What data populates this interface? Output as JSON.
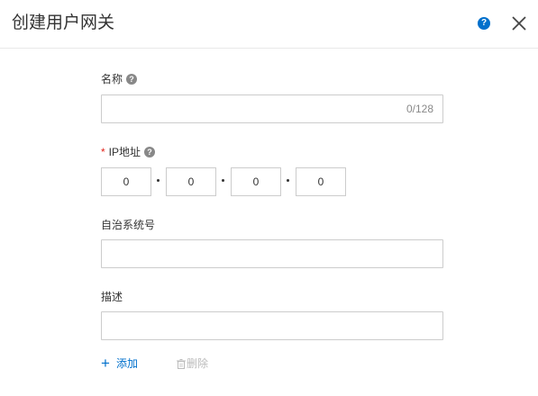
{
  "dialog": {
    "title": "创建用户网关"
  },
  "form": {
    "name": {
      "label": "名称",
      "counter": "0/128",
      "value": ""
    },
    "ip": {
      "label": "IP地址",
      "required_mark": "*",
      "octets": [
        "0",
        "0",
        "0",
        "0"
      ]
    },
    "asn": {
      "label": "自治系统号",
      "value": ""
    },
    "description": {
      "label": "描述",
      "value": ""
    }
  },
  "actions": {
    "add_label": "添加",
    "delete_label": "删除"
  },
  "icons": {
    "help": "help-icon",
    "close": "close-icon",
    "field_help": "question-icon",
    "add": "plus-icon",
    "delete": "trash-icon"
  },
  "colors": {
    "accent": "#0070cc",
    "required": "#e2231a",
    "disabled": "#bbbbbb"
  }
}
